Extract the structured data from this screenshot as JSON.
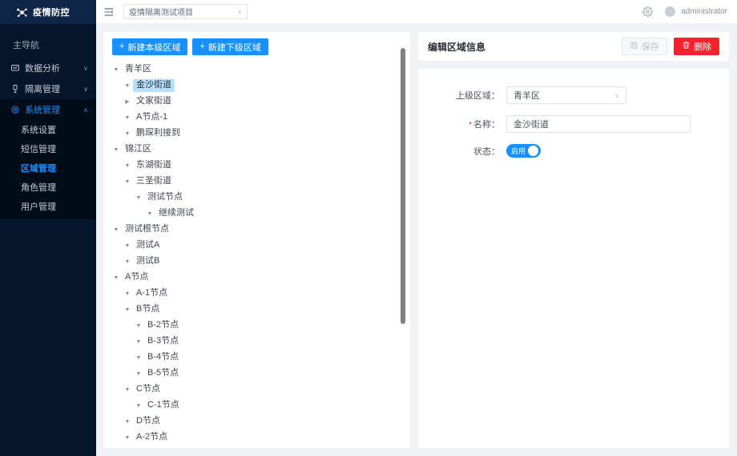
{
  "brand": {
    "logo_text": "疫情防控",
    "logo_icon": "virus-molecule-icon"
  },
  "header": {
    "collapse_icon": "menu-collapse-icon",
    "project_select_value": "疫情隔离测试项目",
    "chevron": "∨",
    "gear_icon": "gear-icon",
    "user_name": "administrator"
  },
  "sidebar": {
    "section_title": "主导航",
    "items": [
      {
        "label": "数据分析",
        "icon": "chart-icon",
        "chevron": "∨",
        "expanded": false
      },
      {
        "label": "隔离管理",
        "icon": "quarantine-icon",
        "chevron": "∨",
        "expanded": false
      },
      {
        "label": "系统管理",
        "icon": "gear-outline-icon",
        "chevron": "∧",
        "expanded": true
      }
    ],
    "submenu": [
      {
        "label": "系统设置",
        "active": false
      },
      {
        "label": "短信管理",
        "active": false
      },
      {
        "label": "区域管理",
        "active": true
      },
      {
        "label": "角色管理",
        "active": false
      },
      {
        "label": "用户管理",
        "active": false
      }
    ]
  },
  "tree_panel": {
    "btn_new_sibling": "新建本级区域",
    "btn_new_child": "新建下级区域",
    "plus": "+",
    "caret_open": "▼",
    "caret_closed": "▶",
    "nodes": [
      {
        "label": "青羊区",
        "depth": 0,
        "open": true,
        "selected": false
      },
      {
        "label": "金沙街道",
        "depth": 1,
        "open": true,
        "selected": true
      },
      {
        "label": "文家街道",
        "depth": 1,
        "open": false,
        "selected": false
      },
      {
        "label": "A节点-1",
        "depth": 1,
        "open": true,
        "selected": false
      },
      {
        "label": "鹏琛利接到",
        "depth": 1,
        "open": true,
        "selected": false
      },
      {
        "label": "锦江区",
        "depth": 0,
        "open": true,
        "selected": false
      },
      {
        "label": "东湖街道",
        "depth": 1,
        "open": true,
        "selected": false
      },
      {
        "label": "三圣街道",
        "depth": 1,
        "open": true,
        "selected": false
      },
      {
        "label": "测试节点",
        "depth": 2,
        "open": true,
        "selected": false
      },
      {
        "label": "继续测试",
        "depth": 3,
        "open": true,
        "selected": false
      },
      {
        "label": "测试根节点",
        "depth": 0,
        "open": true,
        "selected": false
      },
      {
        "label": "测试A",
        "depth": 1,
        "open": true,
        "selected": false
      },
      {
        "label": "测试B",
        "depth": 1,
        "open": true,
        "selected": false
      },
      {
        "label": "A节点",
        "depth": 0,
        "open": true,
        "selected": false
      },
      {
        "label": "A-1节点",
        "depth": 1,
        "open": true,
        "selected": false
      },
      {
        "label": "B节点",
        "depth": 1,
        "open": true,
        "selected": false
      },
      {
        "label": "B-2节点",
        "depth": 2,
        "open": true,
        "selected": false
      },
      {
        "label": "B-3节点",
        "depth": 2,
        "open": true,
        "selected": false
      },
      {
        "label": "B-4节点",
        "depth": 2,
        "open": true,
        "selected": false
      },
      {
        "label": "B-5节点",
        "depth": 2,
        "open": true,
        "selected": false
      },
      {
        "label": "C节点",
        "depth": 1,
        "open": true,
        "selected": false
      },
      {
        "label": "C-1节点",
        "depth": 2,
        "open": true,
        "selected": false
      },
      {
        "label": "D节点",
        "depth": 1,
        "open": true,
        "selected": false
      },
      {
        "label": "A-2节点",
        "depth": 1,
        "open": true,
        "selected": false
      }
    ]
  },
  "edit_panel": {
    "title": "编辑区域信息",
    "save_label": "保存",
    "save_icon": "save-disk-icon",
    "save_disabled": true,
    "delete_label": "删除",
    "delete_icon": "trash-icon",
    "form": {
      "parent_label": "上级区域：",
      "parent_value": "青羊区",
      "parent_chevron": "∨",
      "name_label": "名称：",
      "name_required_mark": "*",
      "name_value": "金沙街道",
      "status_label": "状态：",
      "status_value": "启用",
      "status_on": true
    }
  },
  "colors": {
    "accent": "#1890ff",
    "danger": "#f5222d",
    "sidebar_bg": "#061529",
    "sidebar_sub_bg": "#000c17",
    "page_bg": "#f0f2f5",
    "selected_node_bg": "#bae0ff"
  }
}
